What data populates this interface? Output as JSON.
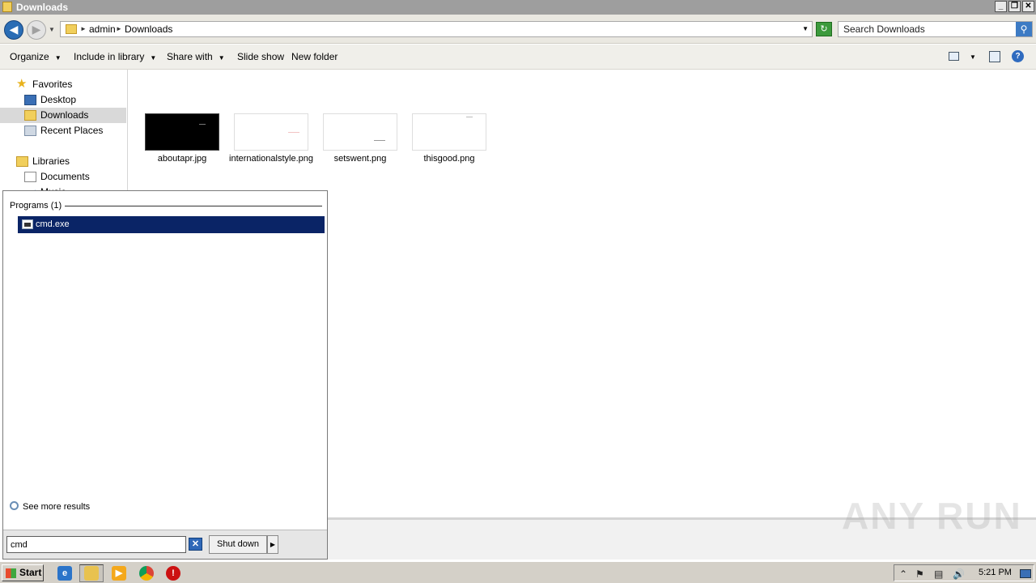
{
  "window": {
    "title": "Downloads"
  },
  "window_controls": {
    "minimize": "_",
    "maximize": "❐",
    "close": "✕"
  },
  "address": {
    "crumbs": [
      "admin",
      "Downloads"
    ],
    "search_placeholder": "Search Downloads"
  },
  "toolbar": {
    "organize": "Organize",
    "include_in_library": "Include in library",
    "share_with": "Share with",
    "slide_show": "Slide show",
    "new_folder": "New folder"
  },
  "nav": {
    "favorites": "Favorites",
    "desktop": "Desktop",
    "downloads": "Downloads",
    "recent_places": "Recent Places",
    "libraries": "Libraries",
    "documents": "Documents",
    "music": "Music"
  },
  "files": [
    {
      "name": "aboutapr.jpg"
    },
    {
      "name": "internationalstyle.png"
    },
    {
      "name": "setswent.png"
    },
    {
      "name": "thisgood.png"
    }
  ],
  "start_menu": {
    "section": "Programs (1)",
    "result": "cmd.exe",
    "see_more": "See more results",
    "search_value": "cmd",
    "shutdown": "Shut down"
  },
  "taskbar": {
    "start": "Start",
    "clock": "5:21 PM"
  },
  "watermark": "ANY RUN"
}
